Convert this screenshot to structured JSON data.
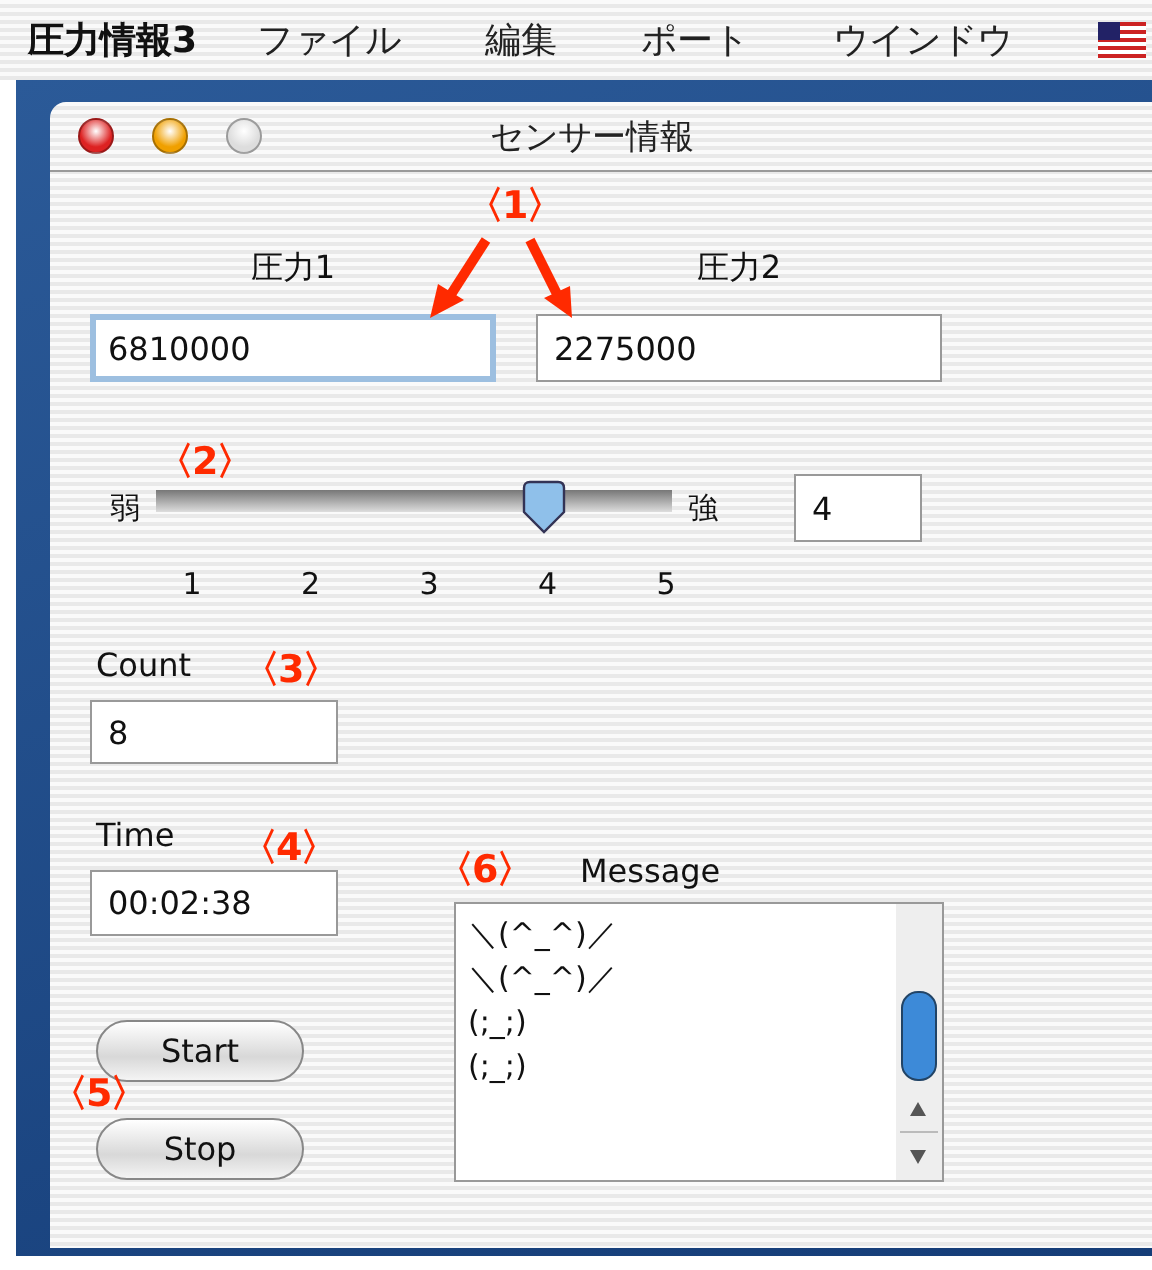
{
  "menu_bar": {
    "app_name": "圧力情報3",
    "items": [
      "ファイル",
      "編集",
      "ポート",
      "ウインドウ"
    ]
  },
  "window": {
    "title": "センサー情報"
  },
  "pressure_fields": [
    {
      "label": "圧力1",
      "value": "6810000",
      "focused": true
    },
    {
      "label": "圧力2",
      "value": "2275000",
      "focused": false
    }
  ],
  "slider": {
    "min_label": "弱",
    "max_label": "強",
    "level": 0.75,
    "ticks": [
      "1",
      "2",
      "3",
      "4",
      "5"
    ],
    "value": "4"
  },
  "count": {
    "label": "Count",
    "value": "8"
  },
  "time": {
    "label": "Time",
    "value": "00:02:38"
  },
  "buttons": [
    "Start",
    "Stop"
  ],
  "message": {
    "label": "Message",
    "lines": [
      "＼(^_^)／",
      "＼(^_^)／",
      "(;_;)",
      "(;_;)"
    ]
  },
  "annotations": [
    "〈1〉",
    "〈2〉",
    "〈3〉",
    "〈4〉",
    "〈5〉",
    "〈6〉"
  ]
}
